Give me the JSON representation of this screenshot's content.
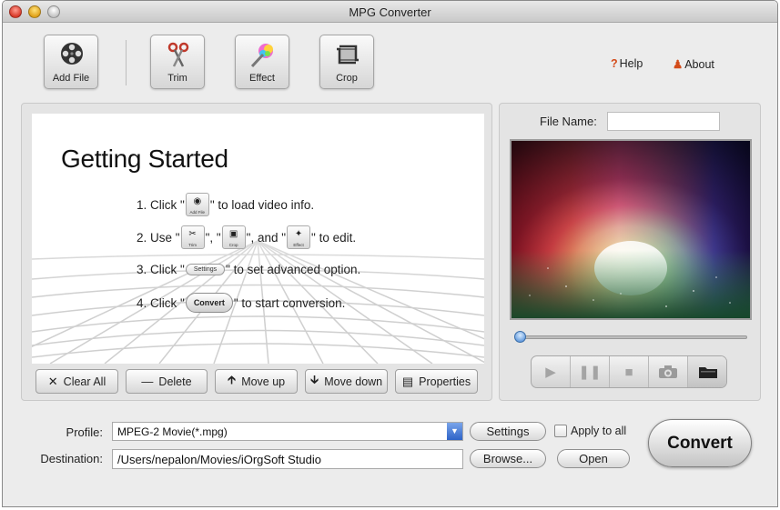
{
  "window": {
    "title": "MPG Converter"
  },
  "toolbar": {
    "add_file": "Add File",
    "trim": "Trim",
    "effect": "Effect",
    "crop": "Crop",
    "help": "Help",
    "about": "About"
  },
  "getting_started": {
    "title": "Getting Started",
    "step1": {
      "prefix": "1. Click \"",
      "icon_label": "Add File",
      "suffix": "\" to load video info."
    },
    "step2": {
      "prefix": "2. Use \"",
      "icon1_label": "Trim",
      "sep1": "\", \"",
      "icon2_label": "Crop",
      "sep2": "\", and \"",
      "icon3_label": "Effect",
      "suffix": "\" to edit."
    },
    "step3": {
      "prefix": "3. Click \"",
      "button_label": "Settings",
      "suffix": "\" to set advanced option."
    },
    "step4": {
      "prefix": "4. Click \"",
      "button_label": "Convert",
      "suffix": "\" to start conversion."
    }
  },
  "list_actions": {
    "clear_all": "Clear All",
    "delete": "Delete",
    "move_up": "Move up",
    "move_down": "Move down",
    "properties": "Properties"
  },
  "preview": {
    "file_name_label": "File Name:",
    "file_name_value": "",
    "position": 0
  },
  "player": {
    "buttons": [
      "play-icon",
      "pause-icon",
      "stop-icon",
      "camera-icon",
      "folder-icon"
    ]
  },
  "output": {
    "profile_label": "Profile:",
    "profile_value": "MPEG-2 Movie(*.mpg)",
    "settings": "Settings",
    "apply_to_all": "Apply to all",
    "apply_to_all_checked": false,
    "destination_label": "Destination:",
    "destination_value": "/Users/nepalon/Movies/iOrgSoft Studio",
    "browse": "Browse...",
    "open": "Open",
    "convert": "Convert"
  },
  "colors": {
    "accent_blue": "#3d7fd1",
    "help_icon": "#d34b1a"
  }
}
